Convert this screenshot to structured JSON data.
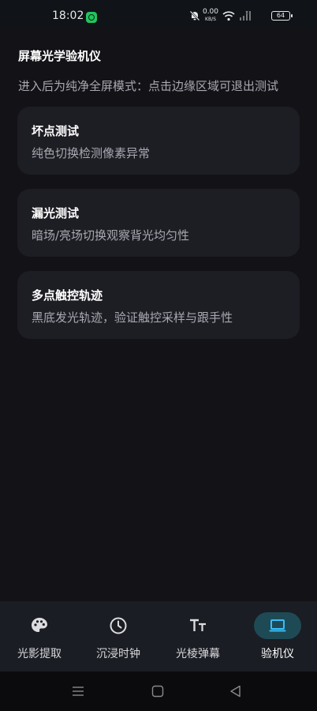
{
  "status_bar": {
    "time": "18:02",
    "net_speed_value": "0.00",
    "net_speed_unit": "KB/S",
    "battery": "64",
    "icons": [
      "app-notification-icon",
      "bell-off-icon",
      "wifi-icon",
      "signal-icon",
      "battery-icon"
    ]
  },
  "header": {
    "title": "屏幕光学验机仪",
    "subtitle": "进入后为纯净全屏模式：点击边缘区域可退出测试"
  },
  "cards": [
    {
      "title": "坏点测试",
      "desc": "纯色切换检测像素异常"
    },
    {
      "title": "漏光测试",
      "desc": "暗场/亮场切换观察背光均匀性"
    },
    {
      "title": "多点触控轨迹",
      "desc": "黑底发光轨迹，验证触控采样与跟手性"
    }
  ],
  "bottom_nav": {
    "items": [
      {
        "label": "光影提取",
        "icon": "palette-icon"
      },
      {
        "label": "沉浸时钟",
        "icon": "clock-icon"
      },
      {
        "label": "光棱弹幕",
        "icon": "text-size-icon"
      },
      {
        "label": "验机仪",
        "icon": "laptop-icon"
      }
    ],
    "active_index": 3
  },
  "colors": {
    "background": "#121217",
    "card": "#1d1d24",
    "nav_background": "#1a1d23",
    "active_pill": "#1e4a55",
    "accent_icon": "#38bdf8"
  }
}
